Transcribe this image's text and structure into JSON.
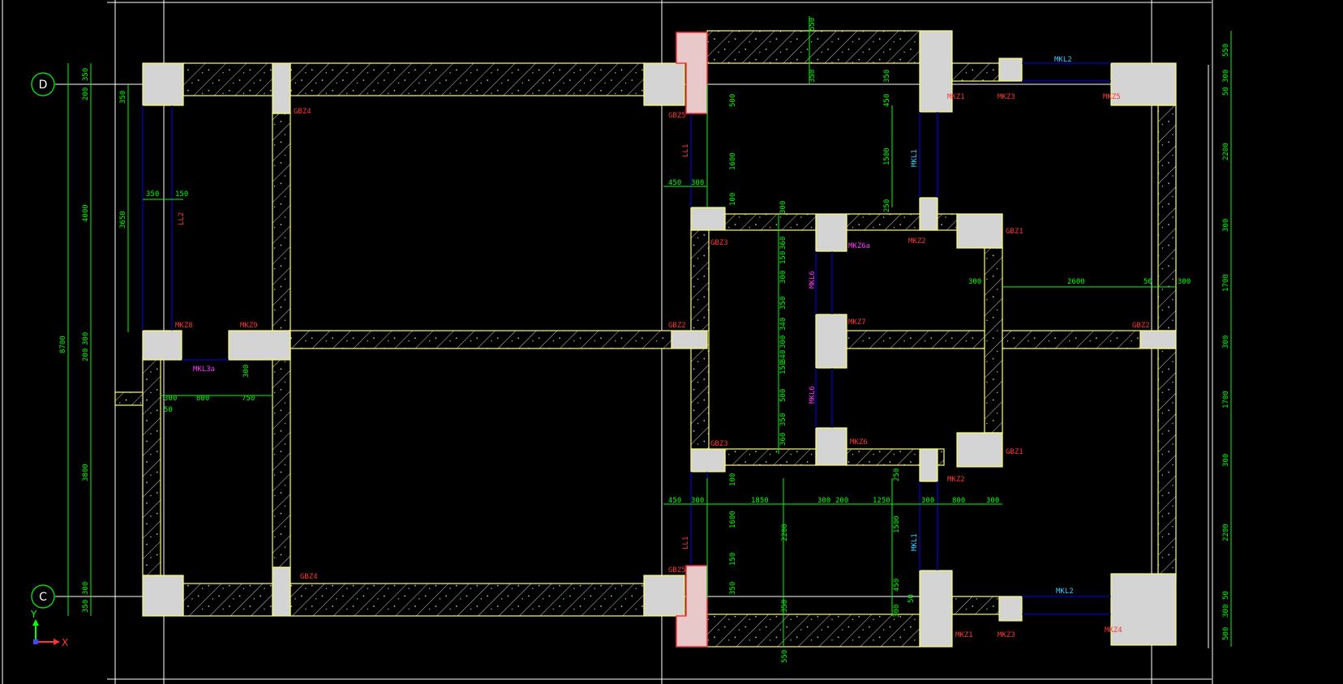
{
  "colors": {
    "background": "#000000",
    "wall_outline": "#ffff66",
    "column_fill": "#d4d4d4",
    "red_fill": "#e8c8c8",
    "dimension": "#00ff00",
    "component_red": "#ff3333",
    "component_magenta": "#ff33ff",
    "component_cyan": "#33ccff",
    "grid_line": "#ffffff",
    "blue_line": "#0000ff"
  },
  "grid_axes": {
    "d": "D",
    "c": "C"
  },
  "ucs": {
    "y": "Y",
    "x": "X"
  },
  "labels": {
    "gbz4_a": "GBZ4",
    "gbz5_a": "GBZ5",
    "mkz8": "MKZ8",
    "mkz9": "MKZ9",
    "gbz2_a": "GBZ2",
    "gbz4_b": "GBZ4",
    "gbz5_b": "GBZ5",
    "gbz3_a": "GBZ3",
    "gbz3_b": "GBZ3",
    "mkz1_a": "MKZ1",
    "mkz3_a": "MKZ3",
    "mkz5": "MKZ5",
    "gbz1_a": "GBZ1",
    "mkz2_a": "MKZ2",
    "mkz7": "MKZ7",
    "gbz2_b": "GBZ2",
    "mkz6": "MKZ6",
    "gbz1_b": "GBZ1",
    "mkz2_b": "MKZ2",
    "mkz1_b": "MKZ1",
    "mkz3_b": "MKZ3",
    "mkz4": "MKZ4",
    "mkz6a": "MKZ6a",
    "mkl3a": "MKL3a",
    "mkl6_a": "MKL6",
    "mkl6_b": "MKL6",
    "mkl2_a": "MKL2",
    "mkl2_b": "MKL2",
    "mkl1_a": "MKL1",
    "mkl1_b": "MKL1",
    "ll2": "LL2",
    "ll1_a": "LL1",
    "ll1_b": "LL1"
  },
  "dimensions": {
    "left_total": "8700",
    "left_350_top": "350",
    "left_200_top": "200",
    "left_4000": "4000",
    "left_200_mid": "200",
    "left_300_mid": "300",
    "left_3800": "3800",
    "left_300_bot": "300",
    "left_350_bot": "350",
    "inner_350": "350",
    "inner_3650": "3650",
    "h_350": "350",
    "h_150": "150",
    "h_300_a": "300",
    "h_800_a": "800",
    "h_750": "750",
    "h_50_a": "50",
    "v_300_mkl3a": "300",
    "top_550": "550",
    "top_350": "350",
    "top_500": "500",
    "top_1600": "1600",
    "top_100": "100",
    "top_450": "450",
    "top_300": "300",
    "top_v350": "350",
    "top_v450": "450",
    "top_v1500": "1500",
    "top_v250": "250",
    "mid_300": "300",
    "mid_360_a": "360",
    "mid_150_a": "150",
    "mid_300_b": "300",
    "mid_350_a": "350",
    "mid_340_a": "340",
    "mid_300_c": "300",
    "mid_150_b": "150",
    "mid_340_b": "340",
    "mid_500": "500",
    "mid_350_b": "350",
    "mid_360_b": "360",
    "right_h_300": "300",
    "right_h_2600": "2600",
    "right_h_50": "50",
    "right_h_300b": "300",
    "bot_450": "450",
    "bot_300_a": "300",
    "bot_1850": "1850",
    "bot_300_b": "300",
    "bot_200": "200",
    "bot_1250": "1250",
    "bot_300_c": "300",
    "bot_800": "800",
    "bot_300_d": "300",
    "bot_v100": "100",
    "bot_v1600": "1600",
    "bot_v150": "150",
    "bot_v350": "350",
    "bot_v2200": "2200",
    "bot_v350b": "350",
    "bot_v550": "550",
    "bot_v250": "250",
    "bot_v1500": "1500",
    "bot_v450": "450",
    "bot_v300": "300",
    "bot_v50": "50",
    "far_550": "550",
    "far_300_a": "300",
    "far_50_a": "50",
    "far_2200_a": "2200",
    "far_300_b": "300",
    "far_1700_a": "1700",
    "far_300_c": "300",
    "far_1700_b": "1700",
    "far_300_d": "300",
    "far_2200_b": "2200",
    "far_50_b": "50",
    "far_300_e": "300",
    "far_500": "500"
  }
}
